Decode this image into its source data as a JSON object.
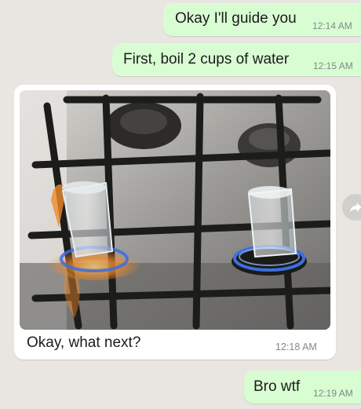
{
  "messages": [
    {
      "direction": "outgoing",
      "text": "Okay I'll guide you",
      "time": "12:14 AM"
    },
    {
      "direction": "outgoing",
      "text": "First, boil 2 cups of water",
      "time": "12:15 AM"
    },
    {
      "direction": "incoming",
      "has_photo": true,
      "photo_subject": "gas stove with two glasses of water on lit burners",
      "caption": "Okay, what next?",
      "time": "12:18 AM"
    },
    {
      "direction": "outgoing",
      "text": "Bro wtf",
      "time": "12:19 AM"
    }
  ],
  "icons": {
    "forward": "share-forward-icon"
  },
  "colors": {
    "chat_background": "#e9e6e2",
    "outgoing_bubble": "#d9fdd3",
    "incoming_bubble": "#ffffff",
    "timestamp": "#7d8b85",
    "flame_blue": "#3b6fe0",
    "flame_orange": "#f08a2a"
  }
}
